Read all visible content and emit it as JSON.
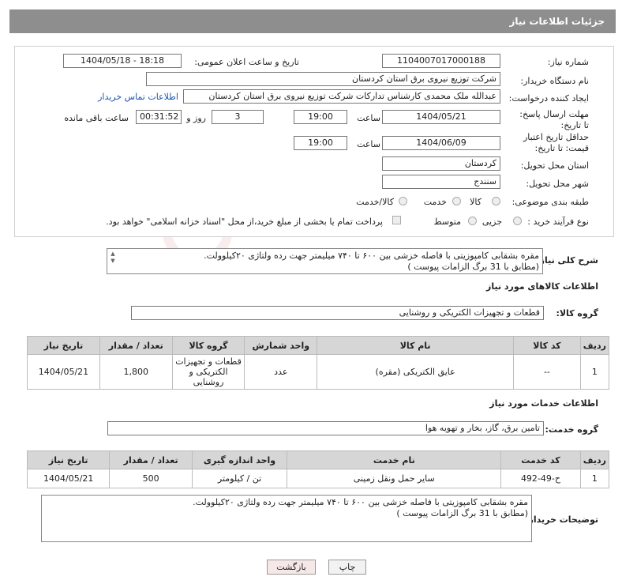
{
  "header": {
    "title": "جزئیات اطلاعات نیاز"
  },
  "form": {
    "need_number_label": "شماره نیاز:",
    "need_number": "1104007017000188",
    "announce_label": "تاریخ و ساعت اعلان عمومی:",
    "announce_value": "1404/05/18 - 18:18",
    "buyer_org_label": "نام دستگاه خریدار:",
    "buyer_org": "شرکت توزیع نیروی برق استان کردستان",
    "creator_label": "ایجاد کننده درخواست:",
    "creator": "عبدالله ملک محمدی کارشناس تدارکات شرکت توزیع نیروی برق استان کردستان",
    "contact_link": "اطلاعات تماس خریدار",
    "reply_deadline_label": "مهلت ارسال پاسخ: تا تاریخ:",
    "reply_date": "1404/05/21",
    "time_label": "ساعت",
    "reply_time": "19:00",
    "days_value": "3",
    "days_label": "روز و",
    "remaining_value": "00:31:52",
    "remaining_label": "ساعت باقی مانده",
    "validity_label": "حداقل تاریخ اعتبار قیمت: تا تاریخ:",
    "validity_date": "1404/06/09",
    "validity_time": "19:00",
    "province_label": "استان محل تحویل:",
    "province": "کردستان",
    "city_label": "شهر محل تحویل:",
    "city": "سنندج",
    "category_label": "طبقه بندی موضوعی:",
    "category_options": [
      "کالا",
      "خدمت",
      "کالا/خدمت"
    ],
    "process_label": "نوع فرآیند خرید :",
    "process_options": [
      "جزیی",
      "متوسط"
    ],
    "payment_note": "پرداخت تمام یا بخشی از مبلغ خرید،از محل \"اسناد خزانه اسلامی\" خواهد بود."
  },
  "summary": {
    "label": "شرح کلی نیاز:",
    "text_line1": "مقره بشقابی کامپوزیتی با فاصله خزشی بین ۶۰۰ تا ۷۴۰ میلیمتر جهت رده ولتاژی ۲۰کیلوولت.",
    "text_line2": "(مطابق با 31 برگ الزامات پیوست )"
  },
  "goods": {
    "section_title": "اطلاعات کالاهای مورد نیاز",
    "group_label": "گروه کالا:",
    "group_value": "قطعات و تجهیزات الکتریکی و روشنایی",
    "columns": [
      "ردیف",
      "کد کالا",
      "نام کالا",
      "واحد شمارش",
      "گروه کالا",
      "تعداد / مقدار",
      "تاریخ نیاز"
    ],
    "rows": [
      {
        "row": "1",
        "code": "--",
        "name": "عایق الکتریکی (مقره)",
        "unit": "عدد",
        "group": "قطعات و تجهیزات الکتریکی و روشنایی",
        "qty": "1,800",
        "date": "1404/05/21"
      }
    ]
  },
  "services": {
    "section_title": "اطلاعات خدمات مورد نیاز",
    "group_label": "گروه خدمت:",
    "group_value": "تامین برق، گاز، بخار و تهویه هوا",
    "columns": [
      "ردیف",
      "کد خدمت",
      "نام خدمت",
      "واحد اندازه گیری",
      "تعداد / مقدار",
      "تاریخ نیاز"
    ],
    "rows": [
      {
        "row": "1",
        "code": "ح-49-492",
        "name": "سایر حمل ونقل زمینی",
        "unit": "تن / کیلومتر",
        "qty": "500",
        "date": "1404/05/21"
      }
    ]
  },
  "buyer_notes": {
    "label": "توضیحات خریدار:",
    "text_line1": "مقره بشقابی کامپوزیتی با فاصله خزشی بین ۶۰۰ تا ۷۴۰ میلیمتر جهت رده ولتاژی ۲۰کیلوولت.",
    "text_line2": "(مطابق با 31 برگ الزامات پیوست )"
  },
  "buttons": {
    "print": "چاپ",
    "back": "بازگشت"
  },
  "watermark": "AriaTender.neT"
}
